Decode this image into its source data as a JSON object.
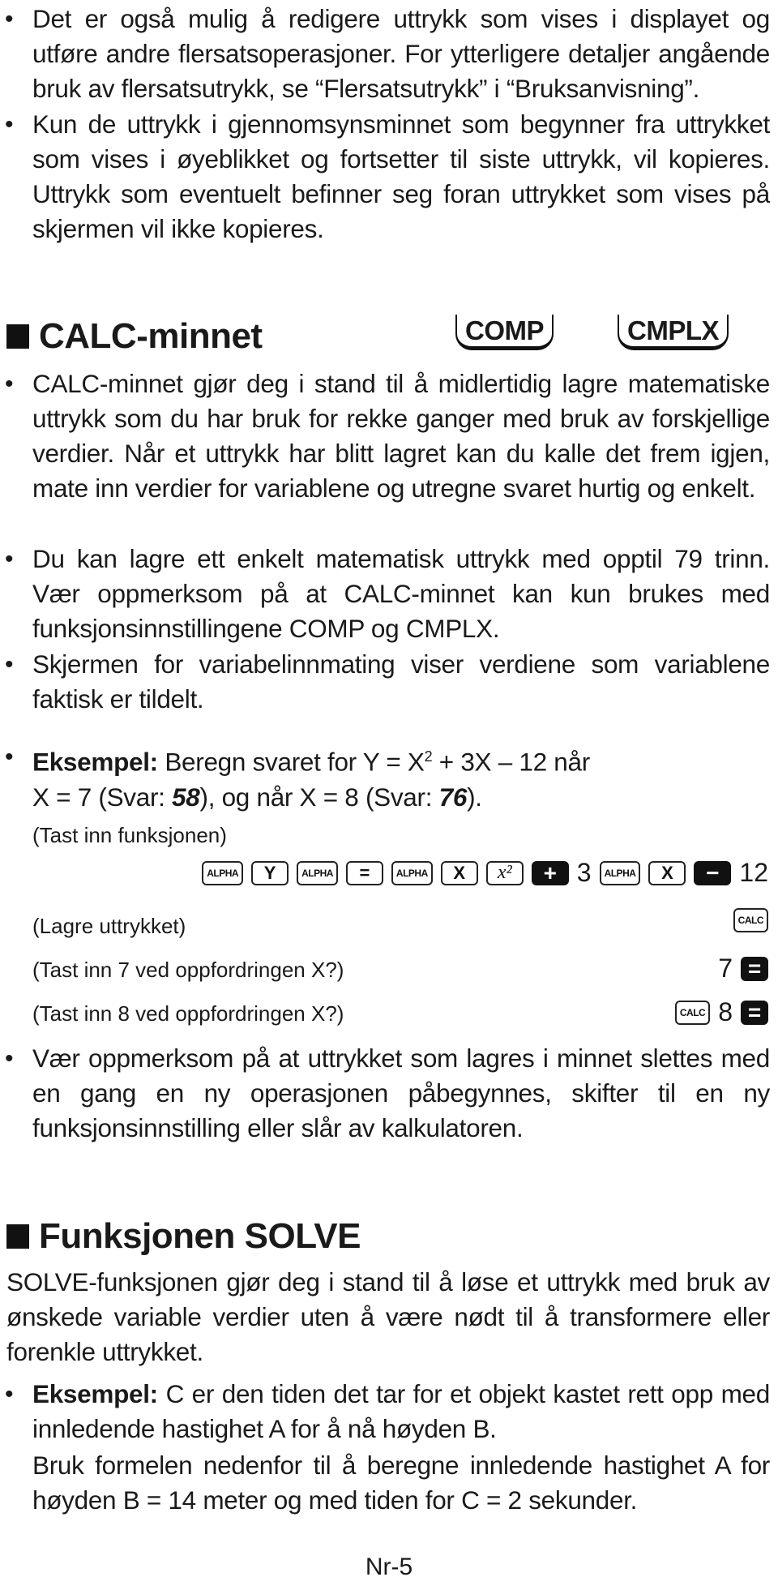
{
  "intro_bullets": [
    "Det er også mulig å redigere uttrykk som vises i displayet og utføre andre flersatsoperasjoner. For ytterligere detaljer angående bruk av flersatsutrykk, se “Flersatsutrykk” i “Bruksanvisning”.",
    "Kun de uttrykk i gjennomsynsminnet som begynner fra uttrykket som vises i øyeblikket og fortsetter til siste uttrykk, vil kopieres. Uttrykk som eventuelt befinner seg foran uttrykket som vises på skjermen vil ikke kopieres."
  ],
  "calc_section": {
    "title": "CALC-minnet",
    "modes": [
      "COMP",
      "CMPLX"
    ],
    "bullets": [
      "CALC-minnet gjør deg i stand til å midlertidig lagre matematiske uttrykk som du har bruk for rekke ganger med bruk av forskjellige verdier. Når et uttrykk har blitt lagret kan du kalle det frem igjen, mate inn verdier for variablene og utregne svaret hurtig og enkelt.",
      "Du kan lagre ett enkelt matematisk uttrykk med opptil 79 trinn. Vær oppmerksom på at CALC-minnet kan kun brukes med funksjonsinnstillingene COMP og CMPLX.",
      "Skjermen for variabelinnmating viser verdiene som variablene faktisk er tildelt."
    ],
    "example": {
      "label": "Eksempel:",
      "line1": "Beregn svaret for Y = X",
      "sup": "2",
      "line1_rest": " + 3X – 12 når",
      "line2_a": "X = 7 (Svar: ",
      "answer1": "58",
      "line2_b": "), og når X = 8 (Svar: ",
      "answer2": "76",
      "line2_c": ")."
    },
    "steps": [
      {
        "label": "(Tast inn funksjonen)",
        "keys": [
          "ALPHA",
          "Y",
          "ALPHA",
          "=",
          "ALPHA",
          "X",
          "x²",
          "+",
          "3",
          "ALPHA",
          "X",
          "−",
          "12"
        ]
      },
      {
        "label": "(Lagre uttrykket)",
        "keys": [
          "CALC"
        ]
      },
      {
        "label": "(Tast inn 7 ved oppfordringen X?)",
        "keys": [
          "7",
          "="
        ]
      },
      {
        "label": "(Tast inn 8 ved oppfordringen X?)",
        "keys": [
          "CALC",
          "8",
          "="
        ]
      }
    ],
    "note": "Vær oppmerksom på at uttrykket som lagres i minnet slettes med en gang en ny operasjonen påbegynnes, skifter til en ny funksjonsinnstilling eller slår av kalkulatoren."
  },
  "solve_section": {
    "title": "Funksjonen SOLVE",
    "intro": "SOLVE-funksjonen gjør deg i stand til å løse et uttrykk med bruk av ønskede variable verdier uten å være nødt til å transformere eller forenkle uttrykket.",
    "example_label": "Eksempel:",
    "example_text": "C er den tiden det tar for et objekt kastet rett opp med innledende hastighet A for å nå høyden B.",
    "example_text2": "Bruk formelen nedenfor til å beregne innledende hastighet A for høyden B = 14 meter og med tiden for C = 2 sekunder."
  },
  "footer": {
    "page_number": "Nr-5"
  }
}
